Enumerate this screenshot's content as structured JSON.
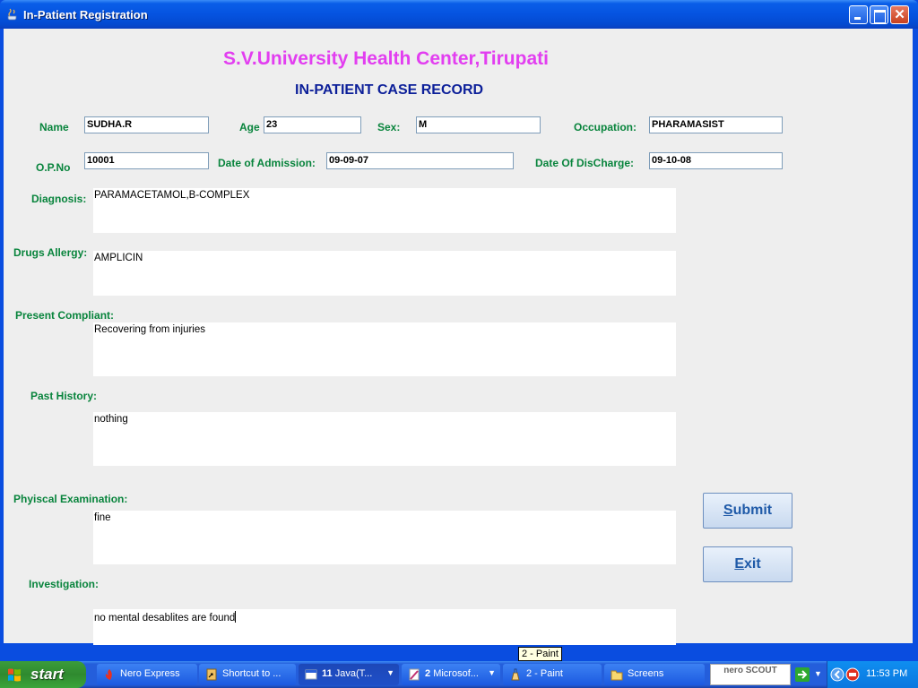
{
  "window": {
    "title": "In-Patient Registration"
  },
  "header": {
    "hospital": "S.V.University Health Center,Tirupati",
    "form_title": "IN-PATIENT CASE RECORD"
  },
  "fields": {
    "name": {
      "label": "Name",
      "value": "SUDHA.R"
    },
    "age": {
      "label": "Age",
      "value": "23"
    },
    "sex": {
      "label": "Sex:",
      "value": "M"
    },
    "occupation": {
      "label": "Occupation:",
      "value": "PHARAMASIST"
    },
    "op_no": {
      "label": "O.P.No",
      "value": "10001"
    },
    "admission": {
      "label": "Date of Admission:",
      "value": "09-09-07"
    },
    "discharge": {
      "label": "Date Of DisCharge:",
      "value": "09-10-08"
    }
  },
  "areas": {
    "diagnosis": {
      "label": "Diagnosis:",
      "value": "PARAMACETAMOL,B-COMPLEX"
    },
    "drugs_allergy": {
      "label": "Drugs Allergy:",
      "value": "AMPLICIN"
    },
    "present_compliant": {
      "label": "Present Compliant:",
      "value": "Recovering from injuries"
    },
    "past_history": {
      "label": "Past History:",
      "value": "nothing"
    },
    "physical_exam": {
      "label": "Phyiscal Examination:",
      "value": "fine"
    },
    "investigation": {
      "label": "Investigation:",
      "value": "no mental desablites are found"
    }
  },
  "buttons": {
    "submit": {
      "mnemonic": "S",
      "rest": "ubmit"
    },
    "exit": {
      "mnemonic": "E",
      "rest": "xit"
    }
  },
  "tooltip": "2 - Paint",
  "taskbar": {
    "start": "start",
    "items": [
      {
        "label": "Nero Express",
        "icon": "nero-flame-icon"
      },
      {
        "label": "Shortcut to ...",
        "icon": "shortcut-icon"
      },
      {
        "count": "11",
        "label": "Java(T...",
        "icon": "window-icon"
      },
      {
        "count": "2",
        "label": "Microsof...",
        "icon": "word-icon"
      },
      {
        "label": "2 - Paint",
        "icon": "paint-icon"
      },
      {
        "label": "Screens",
        "icon": "folder-icon"
      }
    ],
    "nero_scout": "nero SCOUT",
    "clock": "11:53 PM"
  }
}
